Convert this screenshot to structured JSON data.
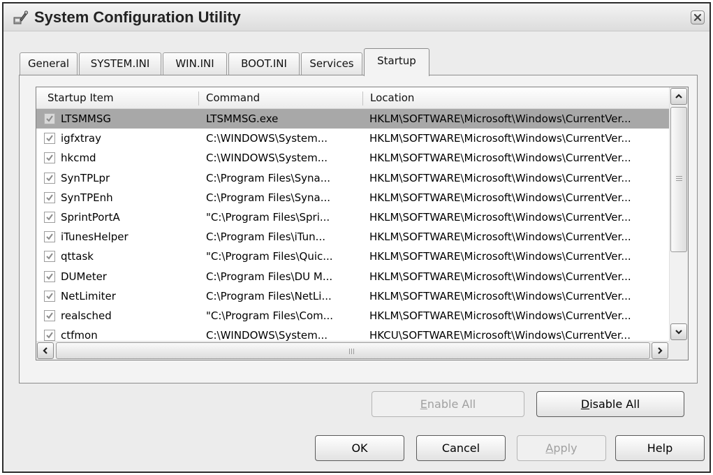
{
  "window": {
    "title": "System Configuration Utility",
    "icon": "msconfig-icon"
  },
  "tabs": [
    {
      "label": "General",
      "active": false
    },
    {
      "label": "SYSTEM.INI",
      "active": false
    },
    {
      "label": "WIN.INI",
      "active": false
    },
    {
      "label": "BOOT.INI",
      "active": false
    },
    {
      "label": "Services",
      "active": false
    },
    {
      "label": "Startup",
      "active": true
    }
  ],
  "startup": {
    "columns": [
      "Startup Item",
      "Command",
      "Location"
    ],
    "rows": [
      {
        "item": "LTSMMSG",
        "command": "LTSMMSG.exe",
        "location": "HKLM\\SOFTWARE\\Microsoft\\Windows\\CurrentVer...",
        "checked": true,
        "selected": true
      },
      {
        "item": "igfxtray",
        "command": "C:\\WINDOWS\\System...",
        "location": "HKLM\\SOFTWARE\\Microsoft\\Windows\\CurrentVer...",
        "checked": true,
        "selected": false
      },
      {
        "item": "hkcmd",
        "command": "C:\\WINDOWS\\System...",
        "location": "HKLM\\SOFTWARE\\Microsoft\\Windows\\CurrentVer...",
        "checked": true,
        "selected": false
      },
      {
        "item": "SynTPLpr",
        "command": "C:\\Program Files\\Syna...",
        "location": "HKLM\\SOFTWARE\\Microsoft\\Windows\\CurrentVer...",
        "checked": true,
        "selected": false
      },
      {
        "item": "SynTPEnh",
        "command": "C:\\Program Files\\Syna...",
        "location": "HKLM\\SOFTWARE\\Microsoft\\Windows\\CurrentVer...",
        "checked": true,
        "selected": false
      },
      {
        "item": "SprintPortA",
        "command": "\"C:\\Program Files\\Spri...",
        "location": "HKLM\\SOFTWARE\\Microsoft\\Windows\\CurrentVer...",
        "checked": true,
        "selected": false
      },
      {
        "item": "iTunesHelper",
        "command": "C:\\Program Files\\iTun...",
        "location": "HKLM\\SOFTWARE\\Microsoft\\Windows\\CurrentVer...",
        "checked": true,
        "selected": false
      },
      {
        "item": "qttask",
        "command": "\"C:\\Program Files\\Quic...",
        "location": "HKLM\\SOFTWARE\\Microsoft\\Windows\\CurrentVer...",
        "checked": true,
        "selected": false
      },
      {
        "item": "DUMeter",
        "command": "C:\\Program Files\\DU M...",
        "location": "HKLM\\SOFTWARE\\Microsoft\\Windows\\CurrentVer...",
        "checked": true,
        "selected": false
      },
      {
        "item": "NetLimiter",
        "command": "C:\\Program Files\\NetLi...",
        "location": "HKLM\\SOFTWARE\\Microsoft\\Windows\\CurrentVer...",
        "checked": true,
        "selected": false
      },
      {
        "item": "realsched",
        "command": "\"C:\\Program Files\\Com...",
        "location": "HKLM\\SOFTWARE\\Microsoft\\Windows\\CurrentVer...",
        "checked": true,
        "selected": false
      },
      {
        "item": "ctfmon",
        "command": "C:\\WINDOWS\\System...",
        "location": "HKCU\\SOFTWARE\\Microsoft\\Windows\\CurrentVer...",
        "checked": true,
        "selected": false
      }
    ],
    "enable_all": {
      "mnemonic": "E",
      "rest": "nable All",
      "disabled": true
    },
    "disable_all": {
      "mnemonic": "D",
      "rest": "isable All",
      "disabled": false
    }
  },
  "footer": {
    "ok": "OK",
    "cancel": "Cancel",
    "apply": {
      "mnemonic": "A",
      "rest": "pply",
      "disabled": true
    },
    "help": "Help"
  },
  "colors": {
    "selected_row": "#a8a8a8",
    "window_face": "#ececec",
    "check_mark": "#8a8a8a"
  }
}
